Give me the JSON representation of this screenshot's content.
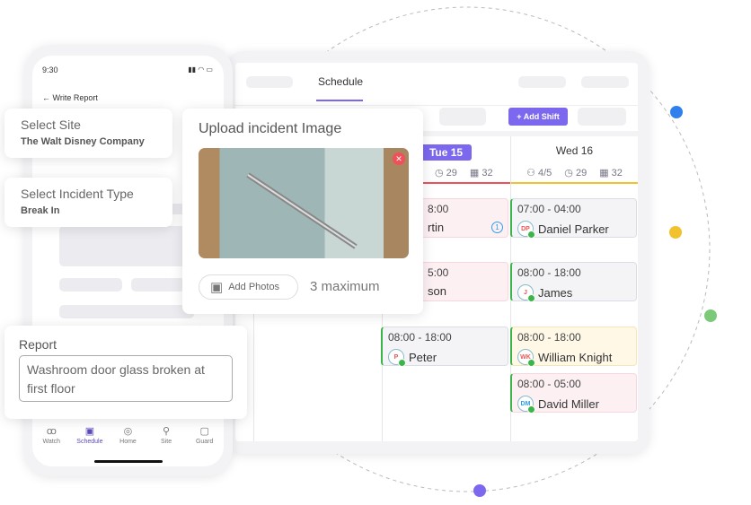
{
  "colors": {
    "accent": "#7b68ee",
    "blue": "#2f80ed",
    "yellow": "#f2c12e",
    "green": "#7dc97a",
    "red": "#f0505a"
  },
  "tablet": {
    "tab": "Schedule",
    "add_shift": "+ Add Shift",
    "days": [
      {
        "label": "Tue 15",
        "stats": {
          "hours": "29",
          "shifts": "32"
        }
      },
      {
        "label": "Wed 16",
        "stats": {
          "guards": "4/5",
          "hours": "29",
          "shifts": "32"
        }
      }
    ],
    "tue_shifts": [
      {
        "time": "8:00",
        "name": "rtin",
        "badge": "1"
      },
      {
        "time": "5:00",
        "name": "son"
      },
      {
        "time": "08:00 - 18:00",
        "name": "Peter",
        "initials": "P"
      }
    ],
    "wed_shifts": [
      {
        "time": "07:00 - 04:00",
        "name": "Daniel Parker",
        "initials": "DP"
      },
      {
        "time": "08:00 - 18:00",
        "name": "James",
        "initials": "J"
      },
      {
        "time": "08:00 - 18:00",
        "name": "William Knight",
        "initials": "WK"
      },
      {
        "time": "08:00 - 05:00",
        "name": "David Miller",
        "initials": "DM"
      }
    ]
  },
  "phone": {
    "time": "9:30",
    "title": "Write Report",
    "nav": [
      {
        "label": "Watch",
        "icon": "binoculars-icon"
      },
      {
        "label": "Schedule",
        "icon": "calendar-icon"
      },
      {
        "label": "Home",
        "icon": "home-icon"
      },
      {
        "label": "Site",
        "icon": "location-pin-icon"
      },
      {
        "label": "Guard",
        "icon": "guard-icon"
      }
    ]
  },
  "select_site": {
    "label": "Select Site",
    "value": "The Walt Disney Company"
  },
  "incident_type": {
    "label": "Select Incident Type",
    "value": "Break In"
  },
  "report": {
    "label": "Report",
    "value": "Washroom door glass broken at first floor"
  },
  "upload": {
    "title": "Upload incident Image",
    "add_photos": "Add Photos",
    "max": "3 maximum"
  }
}
